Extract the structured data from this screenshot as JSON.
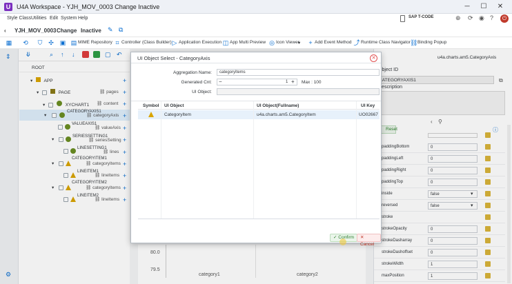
{
  "window": {
    "title": "U4A Workspace - YJH_MOV_0003 Change Inactive",
    "app_icon": "U"
  },
  "menu": {
    "items": [
      "Style Class",
      "Utilities",
      "Edit",
      "System",
      "Help"
    ],
    "sap_label": "SAP T-CODE"
  },
  "header": {
    "app_id": "YJH_MOV_0003",
    "mode": "Change",
    "status": "Inactive"
  },
  "toolbar": {
    "items": [
      "MIME Repository",
      "Controller (Class Builder)",
      "Application Execution",
      "App Multi Preview",
      "Icon Viewer",
      "Add Event Method",
      "Runtime Class Navigator",
      "Binding Popup"
    ]
  },
  "tree": {
    "root": "ROOT",
    "nodes": [
      {
        "name": "APP",
        "agg": ""
      },
      {
        "name": "PAGE",
        "agg": "pages"
      },
      {
        "name": "XYCHART1",
        "agg": "content"
      },
      {
        "name": "CATEGORYAXIS1",
        "agg": "categoryAxis"
      },
      {
        "name": "VALUEAXIS1",
        "agg": "valueAxis"
      },
      {
        "name": "SERIESSETTING1",
        "agg": "seriesSetting"
      },
      {
        "name": "LINESETTING1",
        "agg": "lines"
      },
      {
        "name": "CATEGORYITEM1",
        "agg": "categoryItems"
      },
      {
        "name": "LINEITEM1",
        "agg": "lineItems"
      },
      {
        "name": "CATEGORYITEM2",
        "agg": "categoryItems"
      },
      {
        "name": "LINEITEM2",
        "agg": "lineItems"
      }
    ]
  },
  "chart": {
    "y_ticks": [
      "80.0",
      "79.5"
    ],
    "categories": [
      "category1",
      "category2"
    ]
  },
  "right": {
    "obj_id_label": "Object ID",
    "obj_id": "CATEGORYAXIS1",
    "description_label": "Description",
    "class_name": "u4a.charts.am5.CategoryAxis",
    "reset": "Reset",
    "props": [
      {
        "name": "paddingBottom",
        "value": "0"
      },
      {
        "name": "paddingLeft",
        "value": "0"
      },
      {
        "name": "paddingRight",
        "value": "0"
      },
      {
        "name": "paddingTop",
        "value": "0"
      },
      {
        "name": "inside",
        "value": "false"
      },
      {
        "name": "reversed",
        "value": "false"
      },
      {
        "name": "stroke",
        "value": ""
      },
      {
        "name": "strokeOpacity",
        "value": "0"
      },
      {
        "name": "strokeDasharray",
        "value": "0"
      },
      {
        "name": "strokeDashoffset",
        "value": "0"
      },
      {
        "name": "strokeWidth",
        "value": "1"
      },
      {
        "name": "maxPosition",
        "value": "1"
      }
    ]
  },
  "dialog": {
    "title": "UI Object Select - CategoryAxis",
    "agg_label": "Aggregation Name:",
    "agg_value": "categoryItems",
    "cnt_label": "Generated Cnt:",
    "cnt_value": "1",
    "max_label": "Max : 100",
    "uiobj_label": "UI Object:",
    "columns": [
      "Symbol",
      "UI Object",
      "UI Object(Fullname)",
      "UI Key"
    ],
    "rows": [
      {
        "object": "CategoryItem",
        "fullname": "u4a.charts.am5.CategoryItem",
        "key": "UO02667"
      }
    ],
    "confirm": "Confirm",
    "cancel": "Cancel"
  }
}
